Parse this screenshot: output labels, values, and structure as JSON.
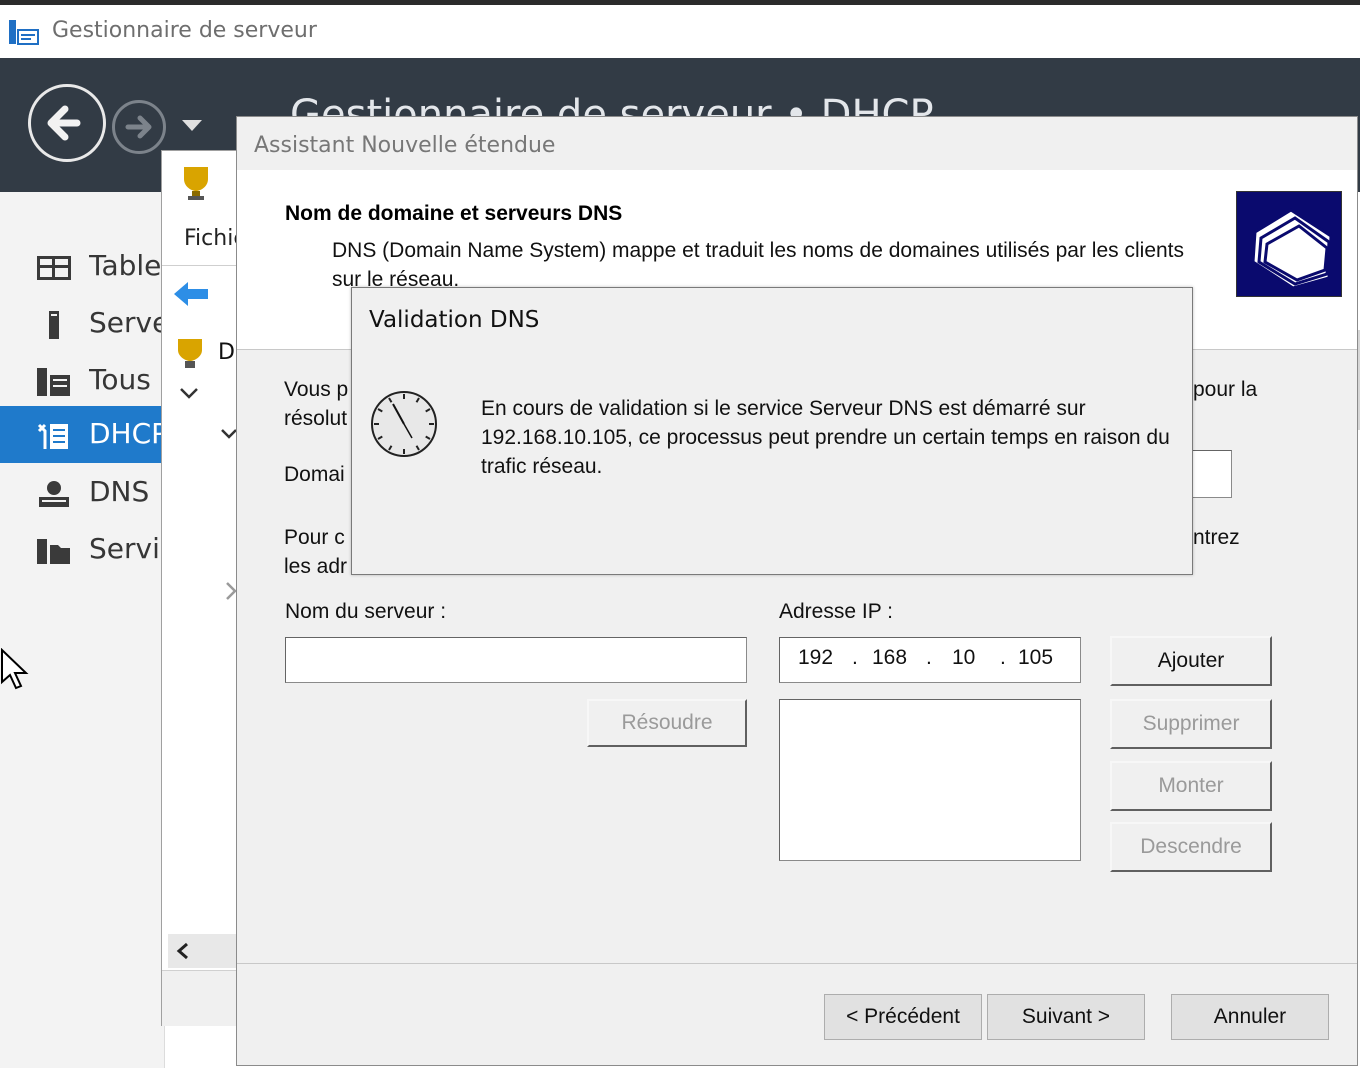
{
  "server_manager": {
    "window_title": "Gestionnaire de serveur",
    "header_title": "Gestionnaire de serveur • DHCP",
    "nav": [
      {
        "label": "Tableau de bord",
        "icon": "dashboard-icon"
      },
      {
        "label": "Serveur local",
        "icon": "server-icon"
      },
      {
        "label": "Tous les serveurs",
        "icon": "servers-icon"
      },
      {
        "label": "DHCP",
        "icon": "dhcp-icon",
        "active": true
      },
      {
        "label": "DNS",
        "icon": "dns-icon"
      },
      {
        "label": "Services de fichiers",
        "icon": "file-services-icon"
      }
    ]
  },
  "mmc": {
    "menu_label": "Fichier",
    "tree_root": "DHCP"
  },
  "wizard": {
    "title": "Assistant Nouvelle étendue",
    "heading": "Nom de domaine et serveurs DNS",
    "subheading": "DNS (Domain Name System) mappe et traduit les noms de domaines utilisés par les clients sur le réseau.",
    "intro_start": "Vous p",
    "intro_end": "pour la",
    "intro_line2": "résolut",
    "domain_label": "Domai",
    "para_start": "Pour c",
    "para_end": "ntrez",
    "para_line2": "les adr",
    "server_name_label": "Nom du serveur :",
    "server_name_value": "",
    "ip_label": "Adresse IP :",
    "ip_octets": [
      "192",
      "168",
      "10",
      "105"
    ],
    "ip_dot": ".",
    "buttons": {
      "resolve": "Résoudre",
      "add": "Ajouter",
      "remove": "Supprimer",
      "up": "Monter",
      "down": "Descendre",
      "back": "< Précédent",
      "next": "Suivant >",
      "cancel": "Annuler"
    }
  },
  "dns_dialog": {
    "title": "Validation DNS",
    "message": "En cours de validation si le service Serveur DNS est démarré sur 192.168.10.105, ce processus peut prendre un certain temps en raison du trafic réseau."
  }
}
